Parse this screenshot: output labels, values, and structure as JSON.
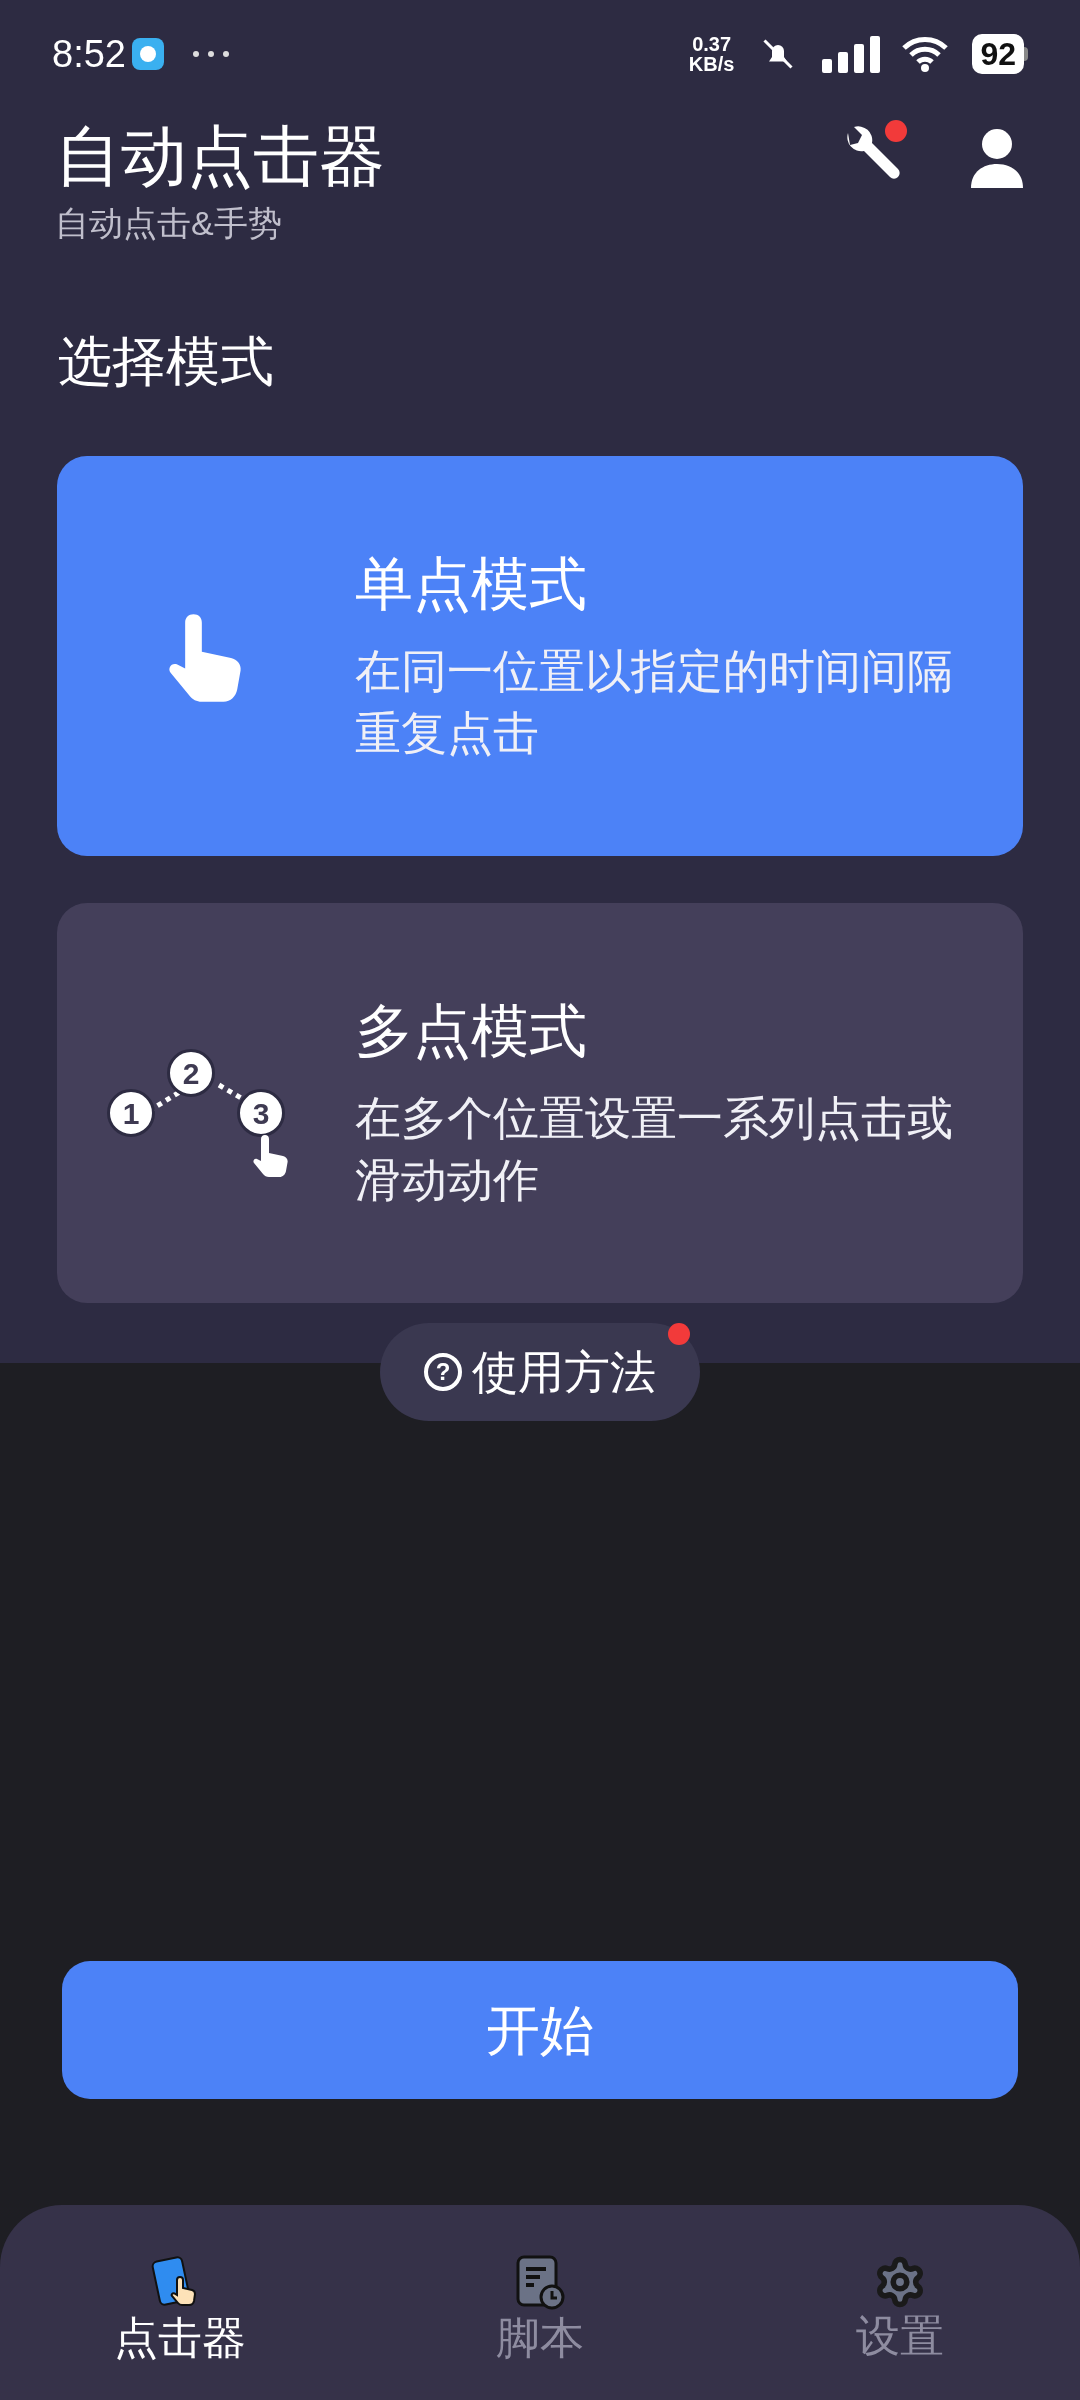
{
  "status_bar": {
    "time": "8:52",
    "speed_value": "0.37",
    "speed_unit": "KB/s",
    "battery": "92"
  },
  "app_bar": {
    "title": "自动点击器",
    "subtitle": "自动点击&手势",
    "tools_dot": true
  },
  "section_title": "选择模式",
  "modes": [
    {
      "kind": "single",
      "title": "单点模式",
      "description": "在同一位置以指定的时间间隔重复点击",
      "selected": true
    },
    {
      "kind": "multi",
      "title": "多点模式",
      "description": "在多个位置设置一系列点击或滑动动作",
      "selected": false,
      "steps": [
        "1",
        "2",
        "3"
      ]
    }
  ],
  "help": {
    "icon": "?",
    "label": "使用方法",
    "dot": true
  },
  "start_button": "开始",
  "nav": [
    {
      "kind": "clicker",
      "label": "点击器",
      "selected": true
    },
    {
      "kind": "script",
      "label": "脚本",
      "selected": false
    },
    {
      "kind": "settings",
      "label": "设置",
      "selected": false
    }
  ]
}
